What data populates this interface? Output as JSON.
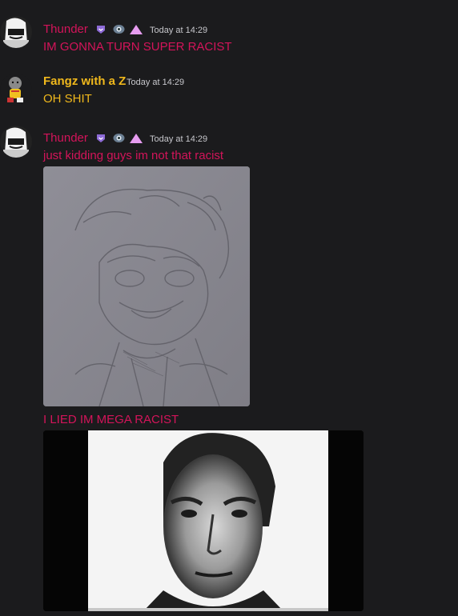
{
  "colors": {
    "thunder": "#d4145a",
    "fangz": "#f0b81c",
    "timestamp": "#c7c7cc",
    "background": "#1b1b1d"
  },
  "messages": [
    {
      "author": "Thunder",
      "badges": [
        "subscriber-badge-icon",
        "eye-badge-icon",
        "triangle-badge-icon"
      ],
      "timestamp": "Today at 14:29",
      "text": "IM GONNA TURN SUPER RACIST"
    },
    {
      "author": "Fangz with a Z",
      "timestamp": "Today at 14:29",
      "text": "OH SHIT"
    },
    {
      "author": "Thunder",
      "badges": [
        "subscriber-badge-icon",
        "eye-badge-icon",
        "triangle-badge-icon"
      ],
      "timestamp": "Today at 14:29",
      "text": "just kidding  guys im not that racist",
      "attachments": [
        "pencil-sketch-image"
      ],
      "followup_text": "I LIED IM MEGA RACIST",
      "followup_attachments": [
        "face-photo-image"
      ]
    }
  ]
}
